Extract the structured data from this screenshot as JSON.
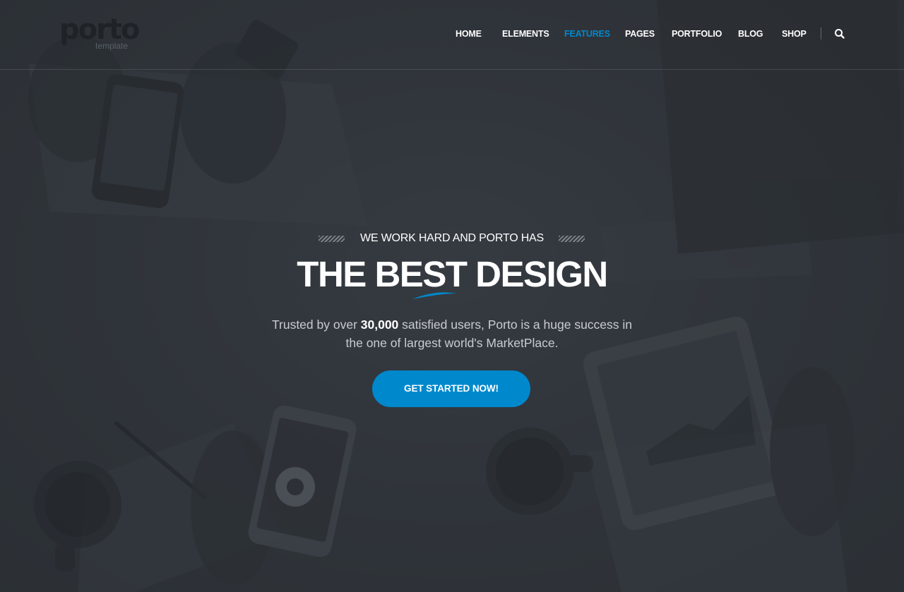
{
  "brand": {
    "logo_text": "porto",
    "logo_sub": "template"
  },
  "nav": {
    "items": [
      {
        "label": "HOME",
        "active": false
      },
      {
        "label": "ELEMENTS",
        "active": false
      },
      {
        "label": "FEATURES",
        "active": true
      },
      {
        "label": "PAGES",
        "active": false
      },
      {
        "label": "PORTFOLIO",
        "active": false
      },
      {
        "label": "BLOG",
        "active": false
      },
      {
        "label": "SHOP",
        "active": false
      }
    ],
    "search_icon": "search-icon"
  },
  "hero": {
    "kicker": "WE WORK HARD AND PORTO HAS",
    "title_part1": "THE ",
    "title_highlight": "BEST",
    "title_part2": " DESIGN",
    "subtitle_pre": "Trusted by over ",
    "subtitle_strong": "30,000",
    "subtitle_post": " satisfied users, Porto is a huge success in",
    "subtitle_line2": "the one of largest world's MarketPlace.",
    "cta_label": "GET STARTED NOW!"
  },
  "colors": {
    "accent": "#0088cc",
    "background": "#2e3238",
    "text": "#ffffff"
  }
}
